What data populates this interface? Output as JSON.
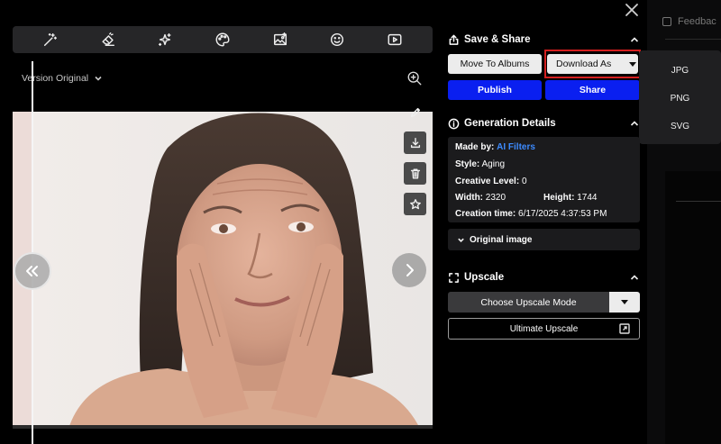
{
  "toolbar": {
    "tools": [
      "magic-wand-icon",
      "eraser-icon",
      "sparkles-icon",
      "palette-icon",
      "image-icon",
      "smiley-icon",
      "video-icon"
    ]
  },
  "version": {
    "label": "Version Original"
  },
  "side_tools": [
    "pencil-icon",
    "download-icon",
    "trash-icon",
    "star-icon"
  ],
  "header": {
    "feedback_label": "Feedbac"
  },
  "save_share": {
    "title": "Save & Share",
    "move_to_albums": "Move To Albums",
    "download_as": "Download As",
    "publish": "Publish",
    "share": "Share"
  },
  "download_menu": {
    "options": [
      "JPG",
      "PNG",
      "SVG"
    ]
  },
  "generation": {
    "title": "Generation Details",
    "made_by_key": "Made by:",
    "made_by_value": "AI Filters",
    "style_key": "Style:",
    "style_value": "Aging",
    "creative_key": "Creative Level:",
    "creative_value": "0",
    "width_key": "Width:",
    "width_value": "2320",
    "height_key": "Height:",
    "height_value": "1744",
    "time_key": "Creation time:",
    "time_value": "6/17/2025 4:37:53 PM",
    "original_image": "Original image"
  },
  "upscale": {
    "title": "Upscale",
    "choose_mode": "Choose Upscale Mode",
    "ultimate": "Ultimate Upscale"
  },
  "colors": {
    "accent_blue": "#0a1ff0",
    "link_blue": "#3d8bff",
    "highlight_red": "#d41f1f"
  }
}
